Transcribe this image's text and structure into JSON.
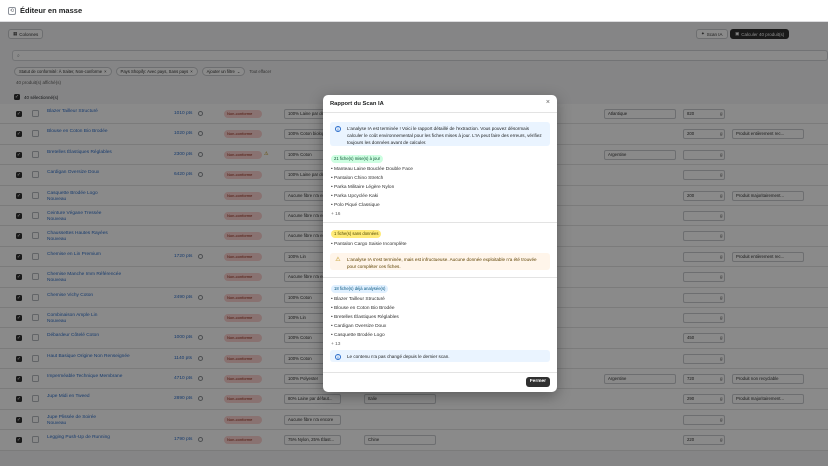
{
  "app": {
    "title": "Éditeur en masse"
  },
  "toolbar": {
    "columns_label": "Colonnes",
    "scan_label": "Scan IA",
    "calc_label": "Calculer 40 produit(s)"
  },
  "search": {
    "placeholder": ""
  },
  "filters": {
    "chips": [
      "Statut de conformité: À traiter, Non-conforme",
      "Pays Shopify: Avec pays, Sans pays",
      "Ajouter un filtre"
    ],
    "clear_label": "Tout effacer"
  },
  "summary": {
    "count": "40 produit(s) affiché(s)",
    "selected": "40 sélectionné(s)"
  },
  "rows": [
    {
      "name": "Blazer Tailleur Structuré",
      "price": "1010 pts",
      "badge": "Non-conforme",
      "composition": "100% Laine par défaut",
      "origin": "Atlantique",
      "weight": "820",
      "category": ""
    },
    {
      "name": "Blouse en Coton Bio Brodée",
      "price": "1020 pts",
      "badge": "Non-conforme",
      "composition": "100% Coton biologique",
      "origin": "",
      "weight": "200",
      "category": "Produit entièrement rec..."
    },
    {
      "name": "Bretelles Élastiques Réglables",
      "price": "2300 pts",
      "badge": "Non-conforme",
      "composition": "100% Coton",
      "origin": "Argentine",
      "weight": "",
      "category": ""
    },
    {
      "name": "Cardigan Oversize Doux",
      "price": "6420 pts",
      "badge": "Non-conforme",
      "composition": "100% Laine par défaut",
      "origin": "",
      "weight": "",
      "category": ""
    },
    {
      "name": "Casquette Brodée Logo",
      "name2": "Nouveau",
      "price": "",
      "badge": "Non-conforme",
      "composition": "Aucune fibre n'a encore",
      "origin": "",
      "weight": "200",
      "category": "Produit majoritairement..."
    },
    {
      "name": "Ceinture Végane Tressée",
      "name2": "Nouveau",
      "price": "",
      "badge": "Non-conforme",
      "composition": "Aucune fibre n'a encore",
      "origin": "",
      "weight": "",
      "category": ""
    },
    {
      "name": "Chaussettes Hautes Rayées",
      "name2": "Nouveau",
      "price": "",
      "badge": "Non-conforme",
      "composition": "Aucune fibre n'a encore",
      "origin": "",
      "weight": "",
      "category": ""
    },
    {
      "name": "Chemise en Lin Premium",
      "price": "1720 pts",
      "badge": "Non-conforme",
      "composition": "100% Lin",
      "origin": "",
      "weight": "",
      "category": "Produit entièrement rec..."
    },
    {
      "name": "Chemise Manche Imm Référencée",
      "name2": "Nouveau",
      "price": "",
      "badge": "Non-conforme",
      "composition": "Aucune fibre n'a encore",
      "origin": "",
      "weight": "",
      "category": ""
    },
    {
      "name": "Chemise Vichy Coton",
      "price": "2490 pts",
      "badge": "Non-conforme",
      "composition": "100% Coton",
      "origin": "",
      "weight": "",
      "category": ""
    },
    {
      "name": "Combinaison Ample Lin",
      "name2": "Nouveau",
      "price": "",
      "badge": "Non-conforme",
      "composition": "100% Lin",
      "origin": "",
      "weight": "",
      "category": ""
    },
    {
      "name": "Débardeur Côtelé Coton",
      "price": "1000 pts",
      "badge": "Non-conforme",
      "composition": "100% Coton",
      "origin": "",
      "weight": "450",
      "category": ""
    },
    {
      "name": "Haut Basique Origine Non Renseignée",
      "price": "1140 pts",
      "badge": "Non-conforme",
      "composition": "100% Coton",
      "origin": "",
      "weight": "",
      "category": ""
    },
    {
      "name": "Imperméable Technique Membrane",
      "price": "4710 pts",
      "badge": "Non-conforme",
      "composition": "100% Polyester",
      "origin": "Argentine",
      "weight": "720",
      "category": "Produit non recyclable"
    },
    {
      "name": "Jupe Midi en Tweed",
      "price": "2890 pts",
      "badge": "Non-conforme",
      "composition": "80% Laine par défaut...",
      "origin": "Italie",
      "weight": "290",
      "category": "Produit majoritairement..."
    },
    {
      "name": "Jupe Plissée de Soirée",
      "name2": "Nouveau",
      "price": "",
      "badge": "Non-conforme",
      "composition": "Aucune fibre n'a encore",
      "origin": "",
      "weight": "",
      "category": ""
    },
    {
      "name": "Legging Push-Up de Running",
      "price": "1790 pts",
      "badge": "Non-conforme",
      "composition": "75% Nylon, 25% Élast...",
      "origin": "Chine",
      "weight": "220",
      "category": ""
    }
  ],
  "units": {
    "g": "g"
  },
  "modal": {
    "title": "Rapport du Scan IA",
    "intro": "L'analyse IA est terminée ! Voici le rapport détaillé de l'extraction. Vous pouvez désormais calculer le coût environnemental pour les fiches mises à jour. L'IA peut faire des erreurs, vérifiez toujours les données avant de calculer.",
    "updated_tag": "21 fiche(s) mise(s) à jour",
    "updated_items": [
      "Manteau Laine Bouclée Double Face",
      "Pantalon Chino Stretch",
      "Parka Militaire Légère Nylon",
      "Parka Upcyclée Kaki",
      "Polo Piqué Classique"
    ],
    "updated_more": "+ 16",
    "partial_tag": "1 fiche(s) sans données",
    "partial_items": [
      "Pantalon Cargo Saisie Incomplète"
    ],
    "warning": "L'analyse IA s'est terminée, mais est infructueuse. Aucune donnée exploitable n'a été trouvée pour compléter ces fiches.",
    "already_tag": "18 fiche(s) déjà analysée(s)",
    "already_items": [
      "Blazer Tailleur Structuré",
      "Blouse en Coton Bio Brodée",
      "Bretelles Élastiques Réglables",
      "Cardigan Oversize Doux",
      "Casquette Brodée Logo"
    ],
    "already_more": "+ 13",
    "unchanged": "Le contenu n'a pas changé depuis le dernier scan.",
    "close_label": "Fermer"
  }
}
